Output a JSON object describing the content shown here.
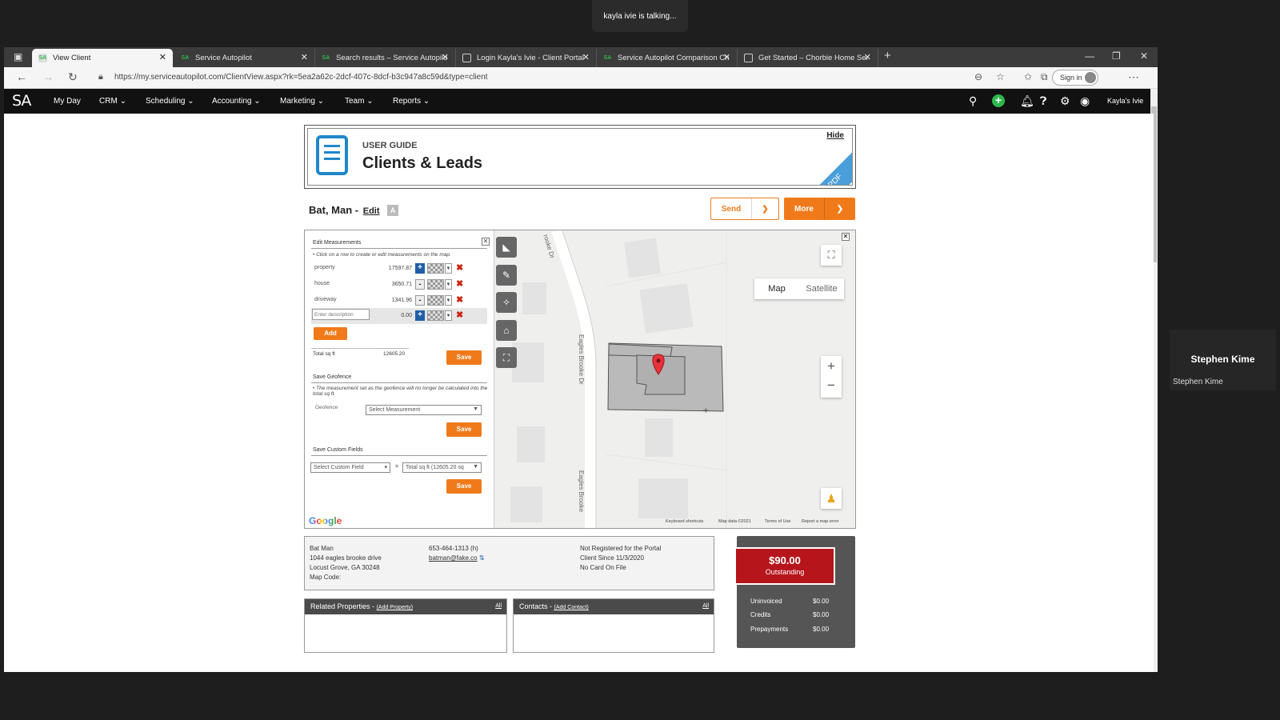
{
  "meeting": {
    "talking": "kayla ivie is talking...",
    "participant_name": "Stephen Kime",
    "participant_label": "Stephen Kime"
  },
  "browser": {
    "tabs": [
      {
        "title": "View Client",
        "favicon": "SA"
      },
      {
        "title": "Service Autopilot",
        "favicon": "SA"
      },
      {
        "title": "Search results – Service Autopilo",
        "favicon": "SA"
      },
      {
        "title": "Login Kayla's Ivie - Client Portal",
        "favicon": "page"
      },
      {
        "title": "Service Autopilot Comparison Ch",
        "favicon": "SA"
      },
      {
        "title": "Get Started – Chorbie Home Ser",
        "favicon": "page"
      }
    ],
    "url": "https://my.serviceautopilot.com/ClientView.aspx?rk=5ea2a62c-2dcf-407c-8dcf-b3c947a8c59d&type=client",
    "signin_label": "Sign in"
  },
  "app": {
    "logo": "SA",
    "nav": [
      "My Day",
      "CRM",
      "Scheduling",
      "Accounting",
      "Marketing",
      "Team",
      "Reports"
    ],
    "username": "Kayla's Ivie",
    "accent_color": "#f07a1a",
    "brand_green": "#2db84c"
  },
  "guide": {
    "small": "USER GUIDE",
    "title": "Clients & Leads",
    "hide": "Hide",
    "badge": "PDF"
  },
  "client": {
    "name": "Bat, Man -",
    "edit": "Edit",
    "send_label": "Send",
    "more_label": "More"
  },
  "measurements": {
    "title": "Edit Measurements",
    "note": "• Click on a row to create or edit measurements on the map.",
    "rows": [
      {
        "name": "property",
        "value": "17597.87",
        "action": "+"
      },
      {
        "name": "house",
        "value": "3650.71",
        "action": "-"
      },
      {
        "name": "driveway",
        "value": "1341.96",
        "action": "-"
      }
    ],
    "new_placeholder": "Enter description",
    "new_value": "0.00",
    "add_label": "Add",
    "total_label": "Total sq ft",
    "total_value": "12605.20",
    "save_label": "Save",
    "geofence_title": "Save Geofence",
    "geofence_note": "• The measurement set as the geofence will no longer be calculated into the total sq ft.",
    "geofence_label": "Geofence",
    "geofence_select": "Select Measurement",
    "custom_title": "Save Custom Fields",
    "custom_select": "Select Custom Field",
    "custom_equals": "=",
    "custom_value": "Total sq ft (12605.20 sq"
  },
  "map": {
    "type_map": "Map",
    "type_satellite": "Satellite",
    "street_top": "rooke Dr",
    "street_mid": "Eagles Brooke Dr",
    "street_bottom": "Eagles Brooke",
    "zoom_in": "+",
    "zoom_out": "−",
    "google": "Google",
    "attribution": [
      "Keyboard shortcuts",
      "Map data ©2021",
      "Terms of Use",
      "Report a map error"
    ]
  },
  "info": {
    "col1": [
      "Bat Man",
      "1044 eagles brooke drive",
      "Locust Grove, GA 30248",
      "Map Code:"
    ],
    "phone": "653-464-1313 (h)",
    "email": "batman@fake.co",
    "col3": [
      "Not Registered for the Portal",
      "Client Since 11/3/2020",
      "No Card On File"
    ]
  },
  "balance": {
    "amount": "$90.00",
    "label": "Outstanding",
    "rows": [
      {
        "label": "Uninvoiced",
        "value": "$0.00"
      },
      {
        "label": "Credits",
        "value": "$0.00"
      },
      {
        "label": "Prepayments",
        "value": "$0.00"
      }
    ]
  },
  "panels": {
    "properties_title": "Related Properties -",
    "properties_link": "(Add Property)",
    "contacts_title": "Contacts -",
    "contacts_link": "(Add Contact)",
    "all_label": "All"
  }
}
